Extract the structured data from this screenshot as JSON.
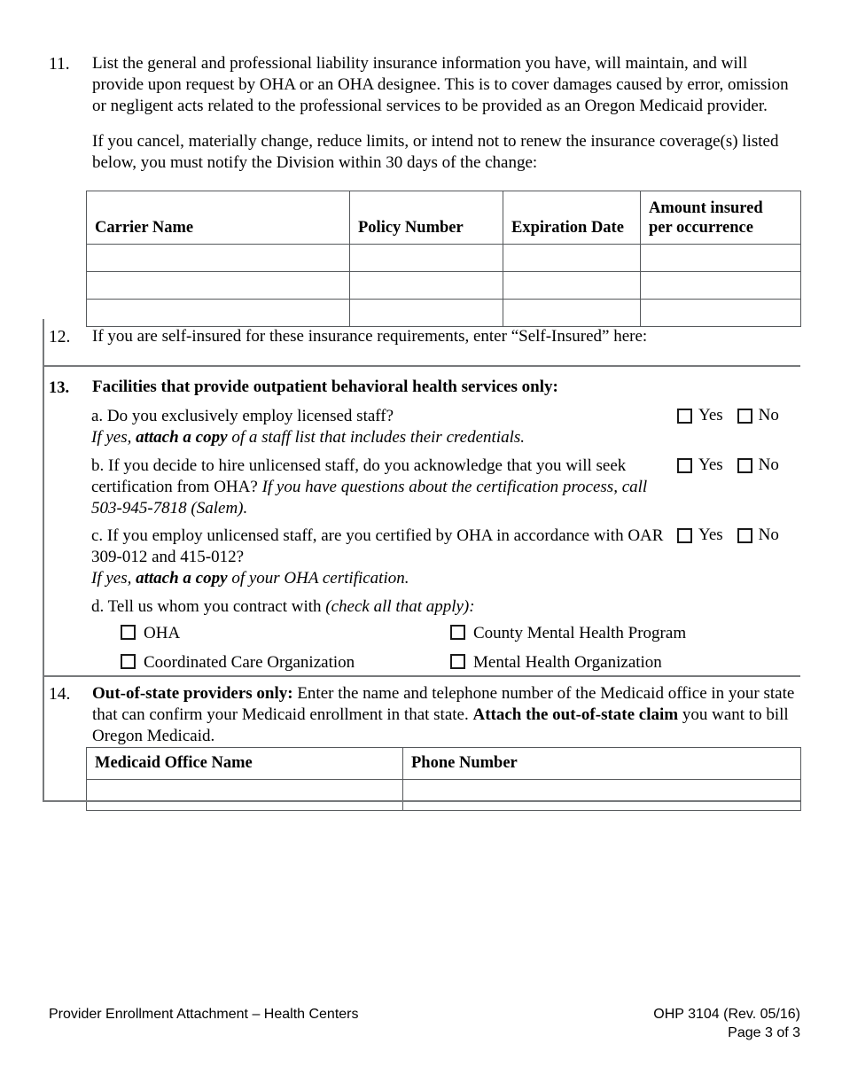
{
  "items": [
    {
      "number": "11.",
      "paragraphs": [
        "List the general and professional liability insurance information you have, will maintain, and will provide upon request by OHA or an OHA designee. This is to cover damages caused by error, omission or negligent acts related to the professional services to be provided as an Oregon Medicaid provider.",
        "If you cancel, materially change, reduce limits, or intend not to renew the insurance coverage(s) listed below, you must notify the Division within 30 days of the change:"
      ]
    },
    {
      "number": "12.",
      "text": "If you are self-insured for these insurance requirements, enter “Self-Insured” here:"
    },
    {
      "number": "13.",
      "heading": "Facilities that provide outpatient behavioral health services only:"
    },
    {
      "number": "14."
    }
  ],
  "insurance_table": {
    "headers": [
      "Carrier Name",
      "Policy Number",
      "Expiration Date",
      "Amount insured per occurrence"
    ],
    "header_amount_line1": "Amount insured",
    "header_amount_line2": "per occurrence",
    "rows": [
      [
        "",
        "",
        "",
        ""
      ],
      [
        "",
        "",
        "",
        ""
      ],
      [
        "",
        "",
        "",
        ""
      ]
    ]
  },
  "section13": {
    "a": {
      "line1": "a. Do you exclusively employ licensed staff?",
      "note_pre": "If yes, ",
      "note_bold": "attach a copy",
      "note_post": " of a staff list that includes their credentials.",
      "yes_label": "Yes",
      "no_label": "No"
    },
    "b": {
      "text_plain": "b. If you decide to hire unlicensed staff, do you acknowledge that you will seek certification from OHA? ",
      "text_italic": "If you have questions about the certification process, call 503-945-7818 (Salem).",
      "yes_label": "Yes",
      "no_label": "No"
    },
    "c": {
      "text_plain": "c. If you employ unlicensed staff, are you certified by OHA in accordance with OAR 309-012 and 415-012?",
      "note_pre": "If yes, ",
      "note_bold": "attach a copy",
      "note_post": " of your OHA certification.",
      "yes_label": "Yes",
      "no_label": "No"
    },
    "d": {
      "text_plain": "d. Tell us whom you contract with ",
      "text_italic": "(check all that apply):",
      "options": [
        "OHA",
        "County Mental Health Program",
        "Coordinated Care Organization",
        "Mental Health Organization"
      ]
    }
  },
  "section14": {
    "lead_bold": "Out-of-state providers only:",
    "body_1": " Enter the name and telephone number of the Medicaid office in your state that can confirm your Medicaid enrollment in that state. ",
    "body_bold_2": "Attach the out-of-state claim",
    "body_3": " you want to bill Oregon Medicaid.",
    "table": {
      "headers": [
        "Medicaid Office Name",
        "Phone Number"
      ],
      "rows": [
        [
          "",
          ""
        ]
      ]
    }
  },
  "footer": {
    "left": "Provider Enrollment Attachment – Health Centers",
    "right_line1": "OHP 3104 (Rev. 05/16)",
    "right_line2": "Page 3 of 3"
  }
}
